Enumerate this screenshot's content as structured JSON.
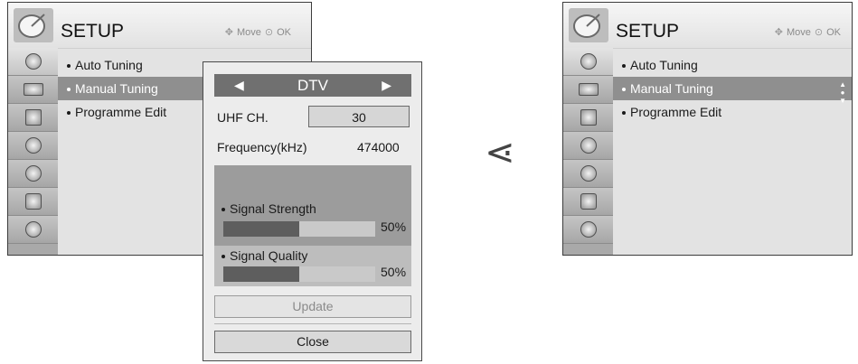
{
  "left_menu": {
    "title": "SETUP",
    "hints": {
      "move": "Move",
      "ok": "OK"
    },
    "items": [
      "Auto Tuning",
      "Manual Tuning",
      "Programme Edit"
    ],
    "selected_index": 1
  },
  "popup": {
    "mode_selector": "DTV",
    "channel_label": "UHF CH.",
    "channel_value": "30",
    "frequency_label": "Frequency(kHz)",
    "frequency_value": "474000",
    "signal_strength_label": "Signal Strength",
    "signal_strength_value": "50%",
    "signal_strength_level": 0.5,
    "signal_quality_label": "Signal Quality",
    "signal_quality_value": "50%",
    "signal_quality_level": 0.5,
    "update_label": "Update",
    "close_label": "Close"
  },
  "compare_symbol": "⋖",
  "right_menu": {
    "title": "SETUP",
    "hints": {
      "move": "Move",
      "ok": "OK"
    },
    "items": [
      "Auto Tuning",
      "Manual Tuning",
      "Programme Edit"
    ],
    "selected_index": 1
  },
  "sidebar_icons": [
    "satellite-dish-icon",
    "tv-screen-icon",
    "speaker-icon",
    "clock-icon",
    "lock-icon",
    "suitcase-icon",
    "globe-icon"
  ]
}
